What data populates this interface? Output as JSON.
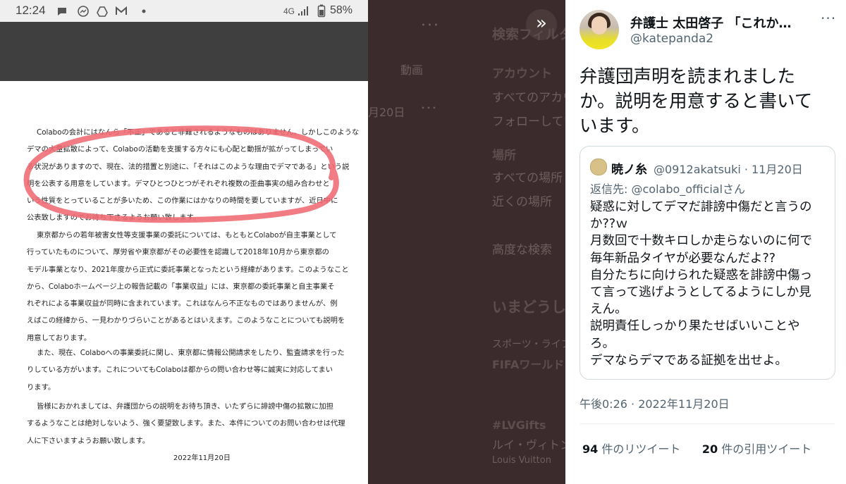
{
  "phone": {
    "status_time": "12:24",
    "status_network": "4G",
    "status_battery": "58%",
    "icons": [
      "message-icon",
      "messenger-icon",
      "drive-icon",
      "gmail-icon",
      "dot-icon",
      "signal-icon",
      "battery-icon"
    ],
    "document": {
      "paragraphs": [
        [
          "Colaboの会計にはなんら「不正」であると非難されるようなものはありません。しかしこのような",
          "デマの大量拡散によって、Colaboの活動を支援する方々にも心配と動揺が拡がってしまってい",
          "る状況がありますので、現在、法的措置と別途に、「それはこのような理由でデマである」という説",
          "明を公表する用意をしています。デマひとつひとつがそれぞれ複数の歪曲事実の組み合わせと",
          "いう性質をとっていることが多いため、この作業にはかなりの時間を要していますが、近日中に",
          "公表致しますのでお待ち下さるようお願い致します。"
        ],
        [
          "東京都からの若年被害女性等支援事業の委託については、もともとColaboが自主事業として",
          "行っていたものについて、厚労省や東京都がその必要性を認識して2018年10月から東京都の",
          "モデル事業となり、2021年度から正式に委託事業となったという経緯があります。このようなこと",
          "から、Colaboホームページ上の報告記載の「事業収益」には、東京都の委託事業と自主事業そ",
          "れぞれによる事業収益が同時に含まれています。これはなんら不正なものではありませんが、例",
          "えばこの経緯から、一見わかりづらいことがあるとはいえます。このようなことについても説明を",
          "用意しております。"
        ],
        [
          "また、現在、Colaboへの事業委託に関し、東京都に情報公開請求をしたり、監査請求を行った",
          "りしている方がいます。これについてもColaboは都からの問い合わせ等に誠実に対応してまい",
          "ります。"
        ],
        [
          "皆様におかれましては、弁護団からの説明をお待ち頂き、いたずらに誹謗中傷の拡散に加担",
          "するようなことは絶対しないよう、強く要望致します。また、本件についてのお問い合わせは代理",
          "人に下さいますようお願い致します。"
        ]
      ],
      "date": "2022年11月20日"
    },
    "annotation_color": "#f06a72"
  },
  "background_page": {
    "more": "･･･",
    "search_filter": "検索フィルター",
    "video_tab": "動画",
    "account_heading": "アカウント",
    "account_all": "すべてのアカウント",
    "account_following": "フォローしているアカウント",
    "date_fragment": "月20日",
    "location_heading": "場所",
    "location_all": "すべての場所",
    "location_near": "近くの場所",
    "advanced_search": "高度な検索",
    "trends_heading": "いまどうしてる？",
    "sports_label": "スポーツ・ライブ",
    "fifa": "FIFAワールドカップ",
    "promo_tag": "#LVGifts",
    "promo_name": "ルイ・ヴィトン",
    "promo_by": "Louis Vuitton"
  },
  "tweet": {
    "author_name": "弁護士 太田啓子 「これか…",
    "author_handle": "@katepanda2",
    "text_lines": [
      "弁護団声明を読まれました",
      "か。説明を用意すると書いて",
      "います。"
    ],
    "quote": {
      "name": "暁ノ糸",
      "meta": "@0912akatsuki · 11月20日",
      "reply_prefix": "返信先: ",
      "reply_to": "@colabo_officialさん",
      "lines": [
        "疑惑に対してデマだ誹謗中傷だと言うの",
        "か??ｗ",
        "月数回で十数キロしか走らないのに何で",
        "毎年新品タイヤが必要なんだよ??",
        "自分たちに向けられた疑惑を誹謗中傷っ",
        "て言って逃げようとしてるようにしか見",
        "えん。",
        "説明責任しっかり果たせばいいことや",
        "ろ。",
        "デマならデマである証拠を出せよ。"
      ]
    },
    "timestamp": "午後0:26 · 2022年11月20日",
    "retweets": "94",
    "retweets_label": "件のリツイート",
    "quotes": "20",
    "quotes_label": "件の引用ツイート",
    "collapse_icon": "double-chevron-right-icon"
  }
}
